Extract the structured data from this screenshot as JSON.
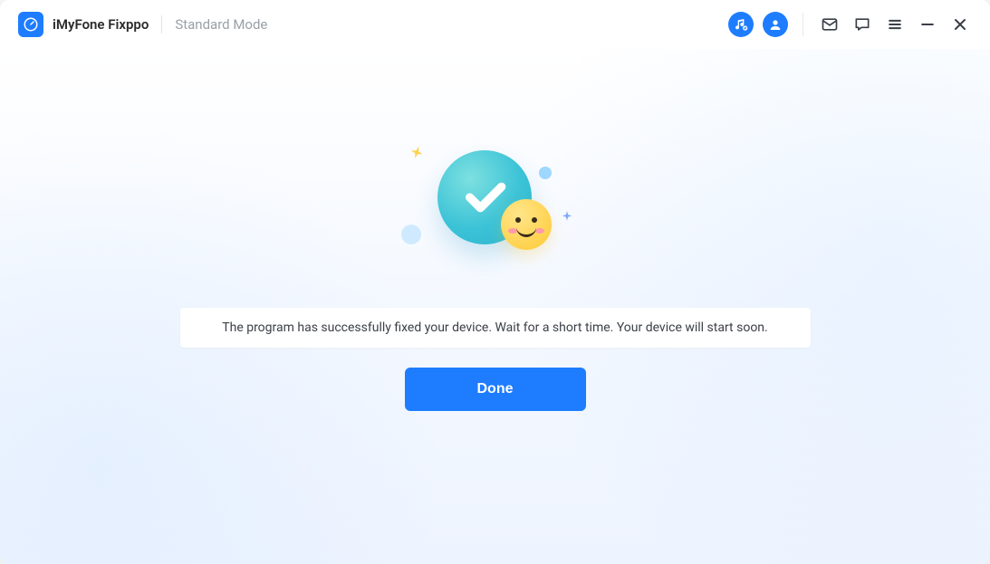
{
  "header": {
    "app_title": "iMyFone Fixppo",
    "mode_label": "Standard Mode"
  },
  "icons": {
    "music": "music-note-icon",
    "account": "user-icon",
    "mail": "mail-icon",
    "chat": "chat-icon",
    "menu": "menu-icon",
    "minimize": "minimize-icon",
    "close": "close-icon"
  },
  "main": {
    "success_message": "The program has successfully fixed your device. Wait for a short time. Your device will start soon.",
    "done_label": "Done"
  },
  "colors": {
    "accent": "#1e7cff",
    "success_teal": "#3cc3d7",
    "smiley_yellow": "#ffd24d"
  }
}
